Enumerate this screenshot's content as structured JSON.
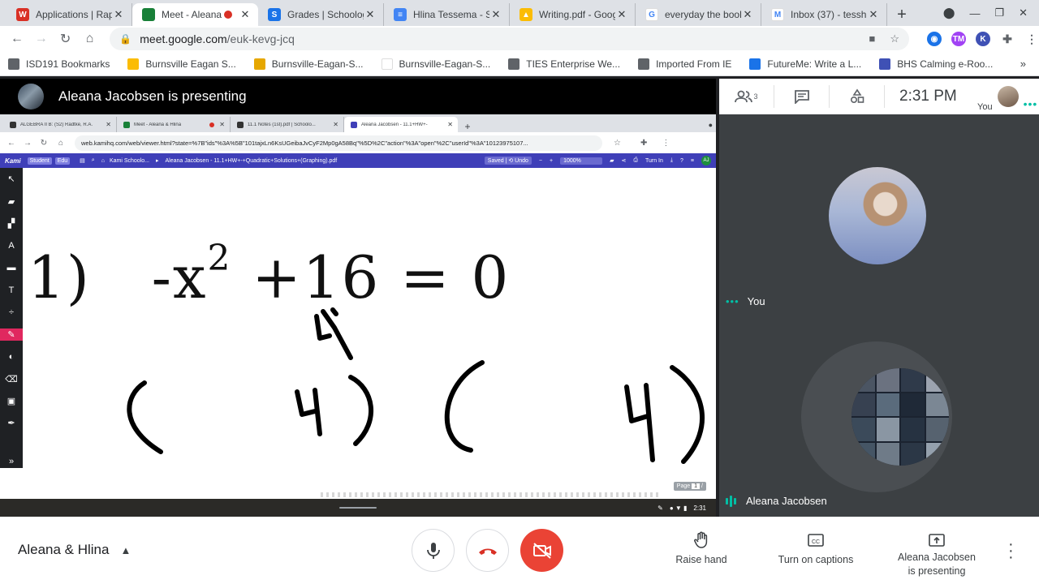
{
  "browser": {
    "tabs": [
      {
        "label": "Applications | Rap",
        "color": "#d93025",
        "glyph": "W",
        "active": false
      },
      {
        "label": "Meet - Aleana",
        "color": "#188038",
        "glyph": "",
        "active": true,
        "recording": true
      },
      {
        "label": "Grades | Schoolog",
        "color": "#1a73e8",
        "glyph": "S",
        "active": false
      },
      {
        "label": "Hlina Tessema - St",
        "color": "#4285f4",
        "glyph": "≡",
        "active": false
      },
      {
        "label": "Writing.pdf - Goog",
        "color": "#fbbc04",
        "glyph": "▲",
        "active": false
      },
      {
        "label": "everyday the book",
        "color": "#ffffff",
        "glyph": "G",
        "active": false
      },
      {
        "label": "Inbox (37) - tessh1",
        "color": "#ffffff",
        "glyph": "M",
        "active": false
      }
    ],
    "url_host": "meet.google.com",
    "url_path": "/euk-kevg-jcq",
    "bookmarks": [
      {
        "label": "ISD191 Bookmarks",
        "icon": "folder-icon",
        "color": "#5f6368"
      },
      {
        "label": "Burnsville Eagan S...",
        "icon": "bes-icon",
        "color": "#fbbc04"
      },
      {
        "label": "Burnsville-Eagan-S...",
        "icon": "bes-tv-icon",
        "color": "#e6a700"
      },
      {
        "label": "Burnsville-Eagan-S...",
        "icon": "google-icon",
        "color": "#ffffff"
      },
      {
        "label": "TIES Enterprise We...",
        "icon": "globe-icon",
        "color": "#5f6368"
      },
      {
        "label": "Imported From IE",
        "icon": "folder-icon",
        "color": "#5f6368"
      },
      {
        "label": "FutureMe: Write a L...",
        "icon": "futureme-icon",
        "color": "#1a73e8"
      },
      {
        "label": "BHS Calming e-Roo...",
        "icon": "calendar-icon",
        "color": "#3f51b5"
      }
    ]
  },
  "meet": {
    "presenting_text": "Aleana Jacobsen is presenting",
    "participants_count": "3",
    "time": "2:31 PM",
    "self_label": "You",
    "tile_you_name": "You",
    "tile_presenter_name": "Aleana Jacobsen",
    "meeting_name": "Aleana & Hlina",
    "raise_hand": "Raise hand",
    "captions": "Turn on captions",
    "presenter_line1": "Aleana Jacobsen",
    "presenter_line2": "is presenting"
  },
  "shared_screen": {
    "tabs": [
      {
        "label": "ALGEBRA II B: (S2) Radtke, R.A.",
        "color": "#333333",
        "active": false
      },
      {
        "label": "Meet - Aleana & Hlina",
        "color": "#188038",
        "active": false,
        "recording": true
      },
      {
        "label": "11.1 Notes (1st).pdf | Schoolo...",
        "color": "#333333",
        "active": false
      },
      {
        "label": "Aleana Jacobsen - 11.1+HW+-",
        "color": "#3f3fb8",
        "active": true
      }
    ],
    "url": "web.kamihq.com/web/viewer.html?state=%7B\"ids\"%3A%5B\"101tajxLn6KsUGeibaJvCyF2Mp0gA58Bq\"%5D%2C\"action\"%3A\"open\"%2C\"userId\"%3A\"10123975107...",
    "kami": {
      "logo": "Kami",
      "badge1": "Student",
      "badge2": "Edu",
      "crumb1": "Kami Schoolo...",
      "doc_title": "Aleana Jacobsen - 11.1+HW+-+Quadratic+Solutions+(Graphing).pdf",
      "saved": "Saved | ⟲ Undo",
      "zoom": "1000%",
      "turn_in": "Turn In",
      "avatar": "AJ"
    },
    "problem_number": "1)",
    "equation_lhs": "-x",
    "equation_exp": "2",
    "equation_rest": " +16 = 0",
    "page_label": "Page",
    "page_number": "1",
    "shelf_time": "2:31"
  }
}
